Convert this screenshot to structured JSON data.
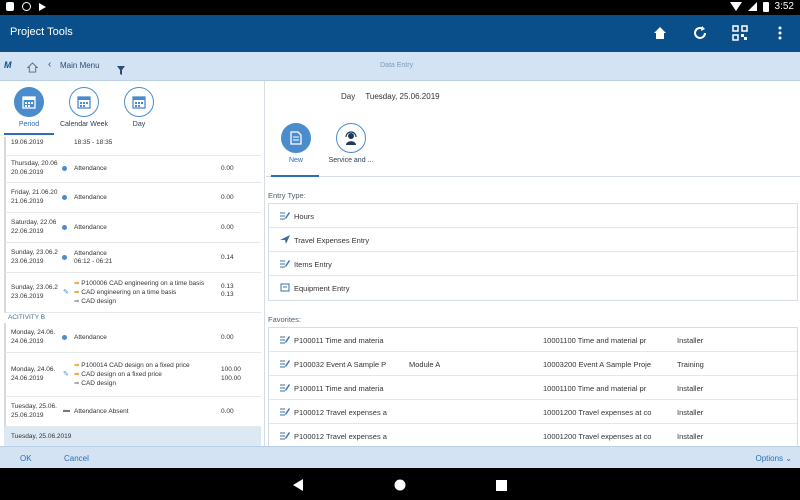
{
  "status_bar": {
    "time": "3:52"
  },
  "app_bar": {
    "title": "Project Tools"
  },
  "sub_bar": {
    "logo": "M",
    "back_label": "Main Menu",
    "page_title": "Data Entry"
  },
  "view_tabs": [
    {
      "label": "Period",
      "active": true
    },
    {
      "label": "Calendar Week",
      "active": false
    },
    {
      "label": "Day",
      "active": false
    }
  ],
  "left_list": {
    "first_row": {
      "date": "19.06.2019",
      "time": "18:35 - 18:35"
    },
    "rows": [
      {
        "date1": "Thursday, 20.06",
        "date2": "20.06.2019",
        "desc": "Attendance",
        "value": "0.00"
      },
      {
        "date1": "Friday, 21.06.20",
        "date2": "21.06.2019",
        "desc": "Attendance",
        "value": "0.00"
      },
      {
        "date1": "Saturday, 22.06",
        "date2": "22.06.2019",
        "desc": "Attendance",
        "value": "0.00"
      },
      {
        "date1": "Sunday, 23.06.2",
        "date2": "23.06.2019",
        "desc": "Attendance",
        "desc2": "06:12 - 06:21",
        "value": "0.14"
      }
    ],
    "row_multi1": {
      "date1": "Sunday, 23.06.2",
      "date2": "23.06.2019",
      "line1": "P100006 CAD engineering on a time basis",
      "line2": "CAD engineering on a time basis",
      "line3": "CAD design",
      "value1": "0.13",
      "value2": "0.13"
    },
    "section": "ACITIVITY B",
    "row_mon": {
      "date1": "Monday, 24.06.",
      "date2": "24.06.2019",
      "desc": "Attendance",
      "value": "0.00"
    },
    "row_multi2": {
      "date1": "Monday, 24.06.",
      "date2": "24.06.2019",
      "line1": "P100014 CAD design on a fixed price",
      "line2": "CAD design on a fixed price",
      "line3": "CAD design",
      "value1": "100.00",
      "value2": "100.00"
    },
    "row_tue": {
      "date1": "Tuesday, 25.06.",
      "date2": "25.06.2019",
      "desc": "Attendance Absent",
      "value": "0.00"
    },
    "selected_row": {
      "date": "Tuesday, 25.06.2019"
    }
  },
  "right": {
    "day_label": "Day",
    "day_value": "Tuesday, 25.06.2019",
    "actions": [
      {
        "label": "New",
        "active": true
      },
      {
        "label": "Service and ...",
        "active": false
      }
    ],
    "entry_type_title": "Entry Type:",
    "entry_types": [
      "Hours",
      "Travel Expenses Entry",
      "Items Entry",
      "Equipment Entry"
    ],
    "favorites_title": "Favorites:",
    "favorites": [
      {
        "c1": "P100011 Time and materia",
        "c2": "",
        "c3": "10001100 Time and material pr",
        "c4": "Installer"
      },
      {
        "c1": "P100032 Event A Sample P",
        "c2": "Module A",
        "c3": "10003200 Event A Sample Proje",
        "c4": "Training"
      },
      {
        "c1": "P100011 Time and materia",
        "c2": "",
        "c3": "10001100 Time and material pr",
        "c4": "Installer"
      },
      {
        "c1": "P100012 Travel expenses a",
        "c2": "",
        "c3": "10001200 Travel expenses at co",
        "c4": "Installer"
      },
      {
        "c1": "P100012 Travel expenses a",
        "c2": "",
        "c3": "10001200 Travel expenses at co",
        "c4": "Installer"
      }
    ]
  },
  "bottom_bar": {
    "ok": "OK",
    "cancel": "Cancel",
    "options": "Options"
  },
  "colors": {
    "primary": "#0b4f8a",
    "accent": "#4a8ccc",
    "bar": "#d4e3f3"
  }
}
